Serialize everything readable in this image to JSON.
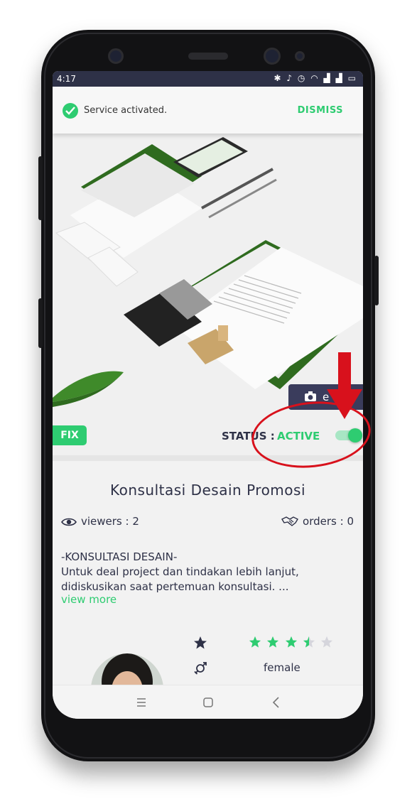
{
  "status_bar": {
    "time": "4:17",
    "icons": [
      "bluetooth-icon",
      "mute-icon",
      "alarm-icon",
      "wifi-icon",
      "signal-icon",
      "signal-icon",
      "battery-icon"
    ]
  },
  "snackbar": {
    "message": "Service activated.",
    "action": "DISMISS"
  },
  "hero": {
    "edit_label": "e"
  },
  "fix_badge": "FIX",
  "status": {
    "label": "STATUS :",
    "value": "ACTIVE",
    "toggle_on": true
  },
  "service": {
    "title": "Konsultasi Desain Promosi",
    "viewers_label": "viewers",
    "viewers_sep": ":",
    "viewers": "2",
    "orders_label": "orders",
    "orders_sep": ":",
    "orders": "0",
    "description_line1": "-KONSULTASI DESAIN-",
    "description_line2": "Untuk deal project dan tindakan lebih lanjut,",
    "description_line3": "didiskusikan saat pertemuan konsultasi. ...",
    "view_more": "view more"
  },
  "profile": {
    "rating": 3.5,
    "rating_max": 5,
    "gender": "female"
  },
  "colors": {
    "accent": "#2ecc71",
    "primary": "#2e3147",
    "annotation": "#d8111c"
  }
}
